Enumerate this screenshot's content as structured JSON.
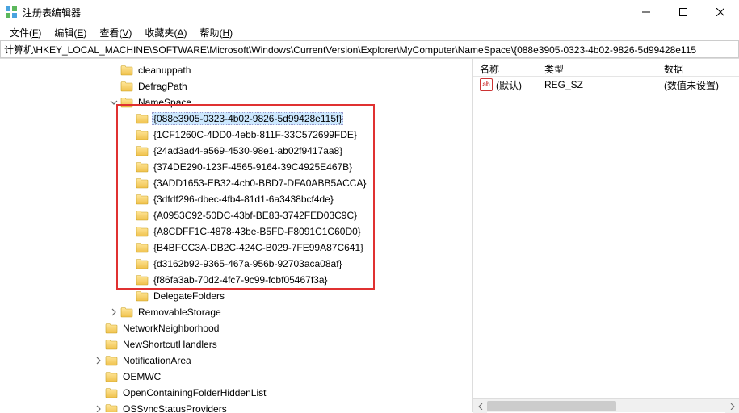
{
  "window": {
    "title": "注册表编辑器"
  },
  "menu": {
    "file": {
      "label": "文件",
      "accel": "F"
    },
    "edit": {
      "label": "编辑",
      "accel": "E"
    },
    "view": {
      "label": "查看",
      "accel": "V"
    },
    "fav": {
      "label": "收藏夹",
      "accel": "A"
    },
    "help": {
      "label": "帮助",
      "accel": "H"
    }
  },
  "address": "计算机\\HKEY_LOCAL_MACHINE\\SOFTWARE\\Microsoft\\Windows\\CurrentVersion\\Explorer\\MyComputer\\NameSpace\\{088e3905-0323-4b02-9826-5d99428e115",
  "tree": {
    "chunks": [
      {
        "indent": 7,
        "expander": null,
        "label": "cleanuppath"
      },
      {
        "indent": 7,
        "expander": null,
        "label": "DefragPath"
      },
      {
        "indent": 7,
        "expander": "open",
        "label": "NameSpace"
      },
      {
        "indent": 8,
        "expander": null,
        "label": "{088e3905-0323-4b02-9826-5d99428e115f}",
        "selected": true
      },
      {
        "indent": 8,
        "expander": null,
        "label": "{1CF1260C-4DD0-4ebb-811F-33C572699FDE}"
      },
      {
        "indent": 8,
        "expander": null,
        "label": "{24ad3ad4-a569-4530-98e1-ab02f9417aa8}"
      },
      {
        "indent": 8,
        "expander": null,
        "label": "{374DE290-123F-4565-9164-39C4925E467B}"
      },
      {
        "indent": 8,
        "expander": null,
        "label": "{3ADD1653-EB32-4cb0-BBD7-DFA0ABB5ACCA}"
      },
      {
        "indent": 8,
        "expander": null,
        "label": "{3dfdf296-dbec-4fb4-81d1-6a3438bcf4de}"
      },
      {
        "indent": 8,
        "expander": null,
        "label": "{A0953C92-50DC-43bf-BE83-3742FED03C9C}"
      },
      {
        "indent": 8,
        "expander": null,
        "label": "{A8CDFF1C-4878-43be-B5FD-F8091C1C60D0}"
      },
      {
        "indent": 8,
        "expander": null,
        "label": "{B4BFCC3A-DB2C-424C-B029-7FE99A87C641}"
      },
      {
        "indent": 8,
        "expander": null,
        "label": "{d3162b92-9365-467a-956b-92703aca08af}"
      },
      {
        "indent": 8,
        "expander": null,
        "label": "{f86fa3ab-70d2-4fc7-9c99-fcbf05467f3a}"
      },
      {
        "indent": 8,
        "expander": null,
        "label": "DelegateFolders"
      },
      {
        "indent": 7,
        "expander": "closed",
        "label": "RemovableStorage"
      },
      {
        "indent": 6,
        "expander": null,
        "label": "NetworkNeighborhood"
      },
      {
        "indent": 6,
        "expander": null,
        "label": "NewShortcutHandlers"
      },
      {
        "indent": 6,
        "expander": "closed",
        "label": "NotificationArea"
      },
      {
        "indent": 6,
        "expander": null,
        "label": "OEMWC"
      },
      {
        "indent": 6,
        "expander": null,
        "label": "OpenContainingFolderHiddenList"
      },
      {
        "indent": 6,
        "expander": "closed",
        "label": "OSSyncStatusProviders"
      }
    ]
  },
  "right": {
    "columns": {
      "name": "名称",
      "type": "类型",
      "data": "数据"
    },
    "rows": [
      {
        "name": "(默认)",
        "type": "REG_SZ",
        "data": "(数值未设置)"
      }
    ]
  }
}
